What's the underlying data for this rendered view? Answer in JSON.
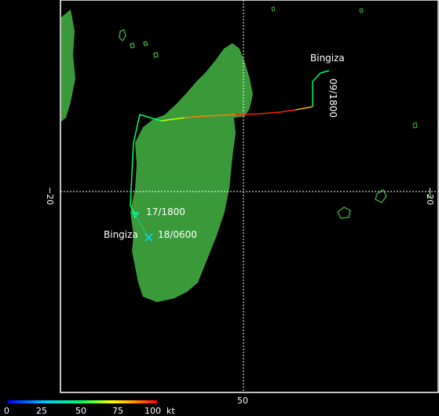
{
  "map": {
    "storm_name_start": "Bingiza",
    "storm_name_end": "Bingiza",
    "timestamp_start": "09/1800",
    "timestamp_mid": "17/1800",
    "timestamp_end": "18/0600",
    "grid": {
      "lat_label_left": "−20",
      "lat_label_right": "−20",
      "lon_label_bottom": "50"
    },
    "colors": {
      "land": "#3a9a3a",
      "island_outline": "#3c9a3c",
      "grid": "#ffffff",
      "frame": "#ffffff"
    }
  },
  "legend": {
    "unit": "kt",
    "ticks": [
      "0",
      "25",
      "50",
      "75",
      "100"
    ],
    "gradient": [
      "#0000ff",
      "#00bfff",
      "#00ff80",
      "#ffff00",
      "#ff8000",
      "#ff0000"
    ]
  }
}
